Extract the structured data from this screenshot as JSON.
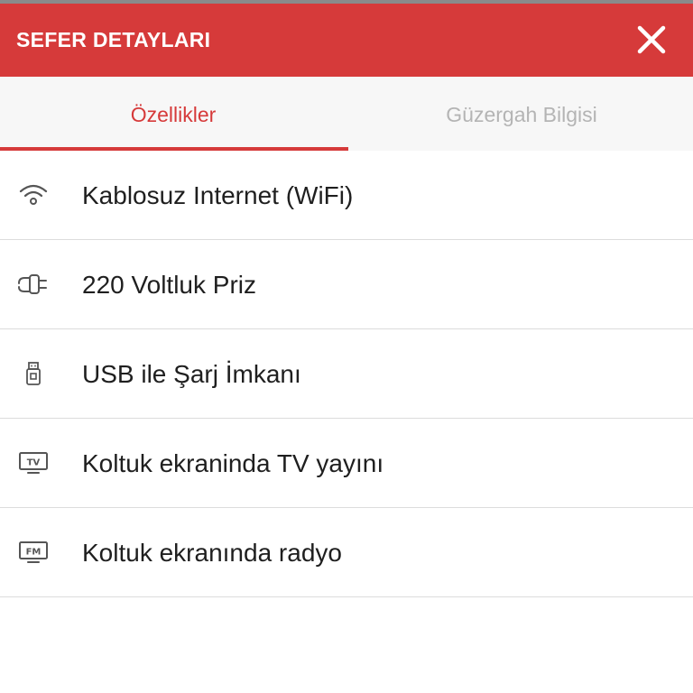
{
  "header": {
    "title": "SEFER DETAYLARI",
    "close_icon": "close-icon"
  },
  "tabs": [
    {
      "label": "Özellikler",
      "active": true
    },
    {
      "label": "Güzergah Bilgisi",
      "active": false
    }
  ],
  "features": [
    {
      "label": "Kablosuz Internet (WiFi)",
      "icon": "wifi-icon"
    },
    {
      "label": "220 Voltluk Priz",
      "icon": "power-plug-icon"
    },
    {
      "label": "USB ile Şarj İmkanı",
      "icon": "usb-icon"
    },
    {
      "label": "Koltuk ekraninda TV yayını",
      "icon": "tv-icon",
      "icon_text": "TV"
    },
    {
      "label": "Koltuk ekranında radyo",
      "icon": "radio-icon",
      "icon_text": "FM"
    }
  ],
  "colors": {
    "accent": "#d63a3a",
    "inactive_tab": "#b4b4b4",
    "text": "#1f1f1f",
    "divider": "#dcdcdc"
  }
}
